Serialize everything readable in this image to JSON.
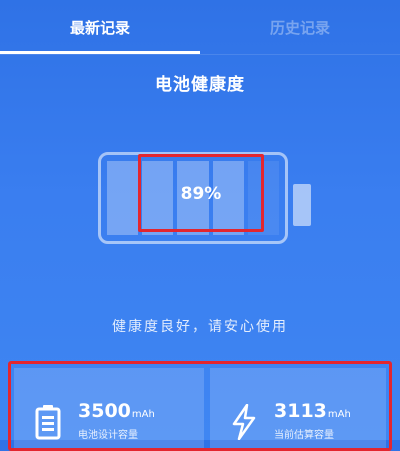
{
  "tabs": {
    "latest": "最新记录",
    "history": "历史记录"
  },
  "title": "电池健康度",
  "battery": {
    "percent_text": "89%",
    "health_fraction": 0.89,
    "filled_cells": 4,
    "total_cells": 5
  },
  "status": "健康度良好，请安心使用",
  "stats": {
    "design": {
      "icon": "battery-icon",
      "value": "3500",
      "unit": "mAh",
      "label": "电池设计容量"
    },
    "estimate": {
      "icon": "lightning-icon",
      "value": "3113",
      "unit": "mAh",
      "label": "当前估算容量"
    }
  },
  "colors": {
    "background_top": "#2f72e6",
    "background_bottom": "#3f86f2",
    "highlight": "#e3262f"
  }
}
